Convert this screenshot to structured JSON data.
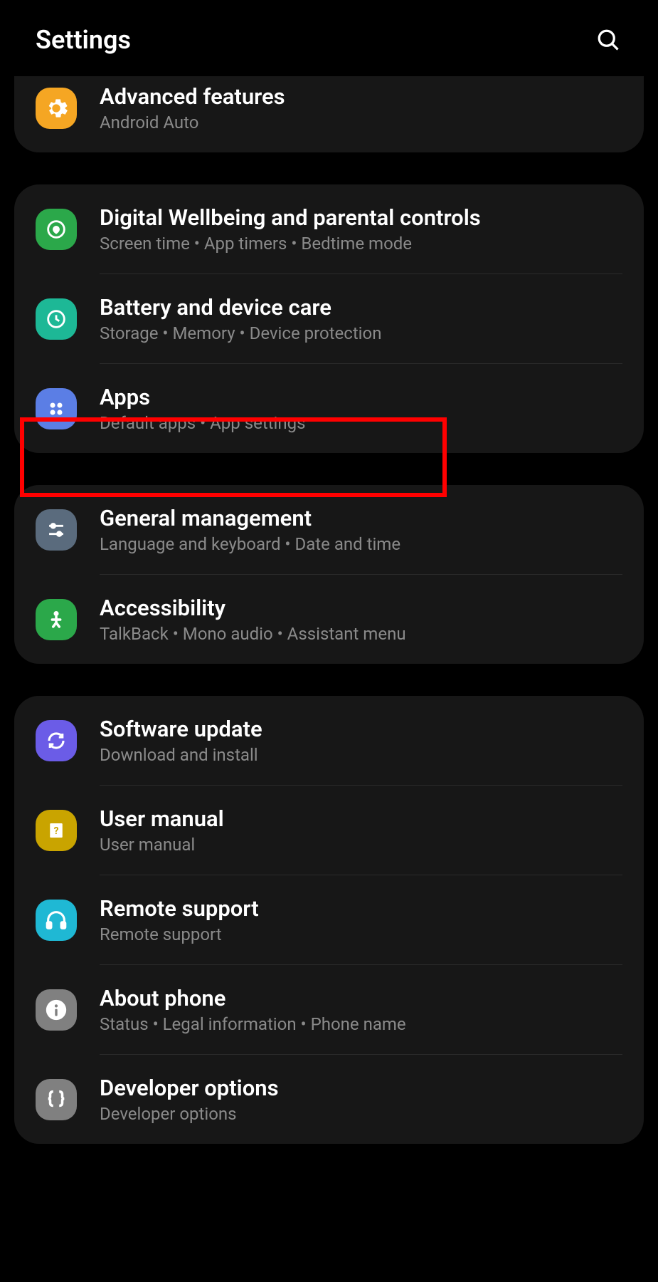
{
  "header": {
    "title": "Settings"
  },
  "groups": [
    {
      "items": [
        {
          "id": "advanced-features",
          "title": "Advanced features",
          "subtitle": "Android Auto",
          "icon": "gear",
          "bg": "bg-orange"
        }
      ]
    },
    {
      "items": [
        {
          "id": "digital-wellbeing",
          "title": "Digital Wellbeing and parental controls",
          "subtitle": "Screen time  •  App timers  •  Bedtime mode",
          "icon": "wellbeing",
          "bg": "bg-green"
        },
        {
          "id": "battery-device-care",
          "title": "Battery and device care",
          "subtitle": "Storage  •  Memory  •  Device protection",
          "icon": "care",
          "bg": "bg-teal"
        },
        {
          "id": "apps",
          "title": "Apps",
          "subtitle": "Default apps  •  App settings",
          "icon": "apps",
          "bg": "bg-blue",
          "highlighted": true
        }
      ]
    },
    {
      "items": [
        {
          "id": "general-management",
          "title": "General management",
          "subtitle": "Language and keyboard  •  Date and time",
          "icon": "sliders",
          "bg": "bg-slate"
        },
        {
          "id": "accessibility",
          "title": "Accessibility",
          "subtitle": "TalkBack  •  Mono audio  •  Assistant menu",
          "icon": "person",
          "bg": "bg-greenb"
        }
      ]
    },
    {
      "items": [
        {
          "id": "software-update",
          "title": "Software update",
          "subtitle": "Download and install",
          "icon": "update",
          "bg": "bg-purple"
        },
        {
          "id": "user-manual",
          "title": "User manual",
          "subtitle": "User manual",
          "icon": "book",
          "bg": "bg-yellow"
        },
        {
          "id": "remote-support",
          "title": "Remote support",
          "subtitle": "Remote support",
          "icon": "headphones",
          "bg": "bg-cyan"
        },
        {
          "id": "about-phone",
          "title": "About phone",
          "subtitle": "Status  •  Legal information  •  Phone name",
          "icon": "info",
          "bg": "bg-gray"
        },
        {
          "id": "developer-options",
          "title": "Developer options",
          "subtitle": "Developer options",
          "icon": "braces",
          "bg": "bg-grayb"
        }
      ]
    }
  ]
}
